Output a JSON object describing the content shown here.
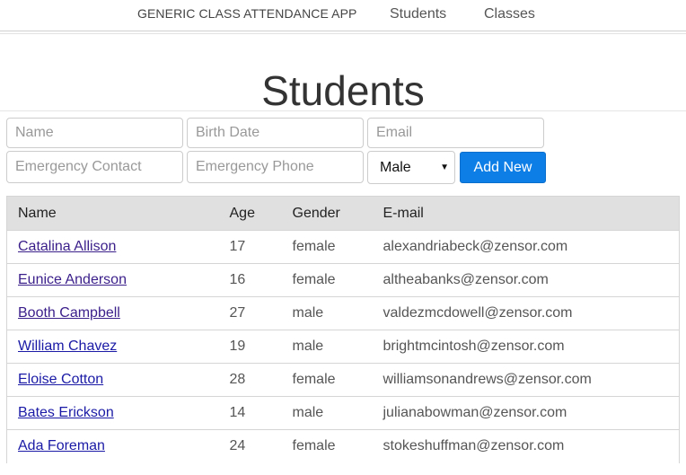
{
  "nav": {
    "brand": "GENERIC CLASS ATTENDANCE APP",
    "links": [
      "Students",
      "Classes"
    ]
  },
  "page": {
    "title": "Students"
  },
  "form": {
    "name_placeholder": "Name",
    "birth_placeholder": "Birth Date",
    "email_placeholder": "Email",
    "emergency_contact_placeholder": "Emergency Contact",
    "emergency_phone_placeholder": "Emergency Phone",
    "gender_selected": "Male",
    "add_label": "Add New"
  },
  "table": {
    "headers": [
      "Name",
      "Age",
      "Gender",
      "E-mail"
    ],
    "rows": [
      {
        "name": "Catalina Allison",
        "age": "17",
        "gender": "female",
        "email": "alexandriabeck@zensor.com"
      },
      {
        "name": "Eunice Anderson",
        "age": "16",
        "gender": "female",
        "email": "altheabanks@zensor.com"
      },
      {
        "name": "Booth Campbell",
        "age": "27",
        "gender": "male",
        "email": "valdezmcdowell@zensor.com"
      },
      {
        "name": "William Chavez",
        "age": "19",
        "gender": "male",
        "email": "brightmcintosh@zensor.com"
      },
      {
        "name": "Eloise Cotton",
        "age": "28",
        "gender": "female",
        "email": "williamsonandrews@zensor.com"
      },
      {
        "name": "Bates Erickson",
        "age": "14",
        "gender": "male",
        "email": "julianabowman@zensor.com"
      },
      {
        "name": "Ada Foreman",
        "age": "24",
        "gender": "female",
        "email": "stokeshuffman@zensor.com"
      }
    ]
  },
  "colors": {
    "primary_button": "#0d7ee6",
    "table_header_bg": "#e0e0e0",
    "link_visited": "#3a1e8a",
    "link": "#1a1aa6"
  }
}
